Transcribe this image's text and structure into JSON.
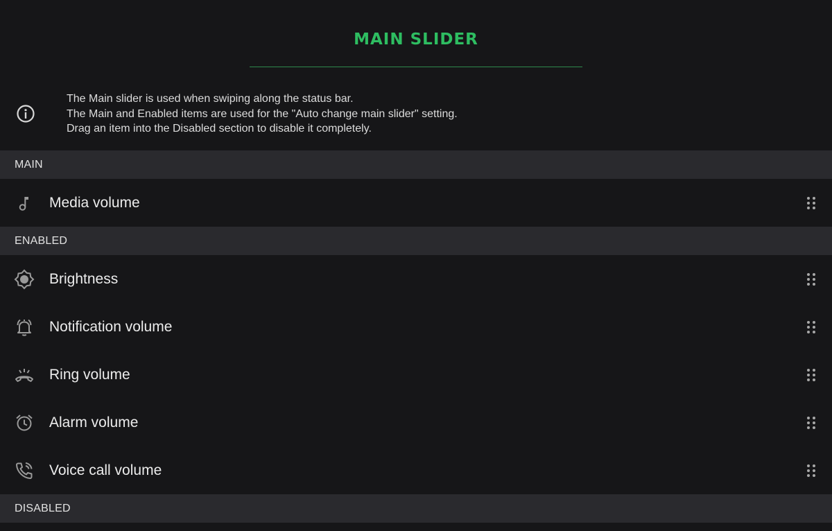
{
  "header": {
    "title": "MAIN SLIDER"
  },
  "info": {
    "icon": "info-icon",
    "lines": [
      "The Main slider is used when swiping along the status bar.",
      "The Main and Enabled items are used for the \"Auto change main slider\" setting.",
      "Drag an item into the Disabled section to disable it completely."
    ]
  },
  "sections": {
    "main": {
      "label": "MAIN",
      "items": [
        {
          "label": "Media volume",
          "icon": "music-note-icon"
        }
      ]
    },
    "enabled": {
      "label": "ENABLED",
      "items": [
        {
          "label": "Brightness",
          "icon": "brightness-icon"
        },
        {
          "label": "Notification volume",
          "icon": "notification-bell-icon"
        },
        {
          "label": "Ring volume",
          "icon": "ring-phone-icon"
        },
        {
          "label": "Alarm volume",
          "icon": "alarm-clock-icon"
        },
        {
          "label": "Voice call volume",
          "icon": "voice-call-icon"
        }
      ]
    },
    "disabled": {
      "label": "DISABLED",
      "items": []
    }
  },
  "colors": {
    "accent": "#2ebd61",
    "background": "#161618",
    "section_header_bg": "#2a2a2e",
    "icon_gray": "#9a9a9a"
  }
}
